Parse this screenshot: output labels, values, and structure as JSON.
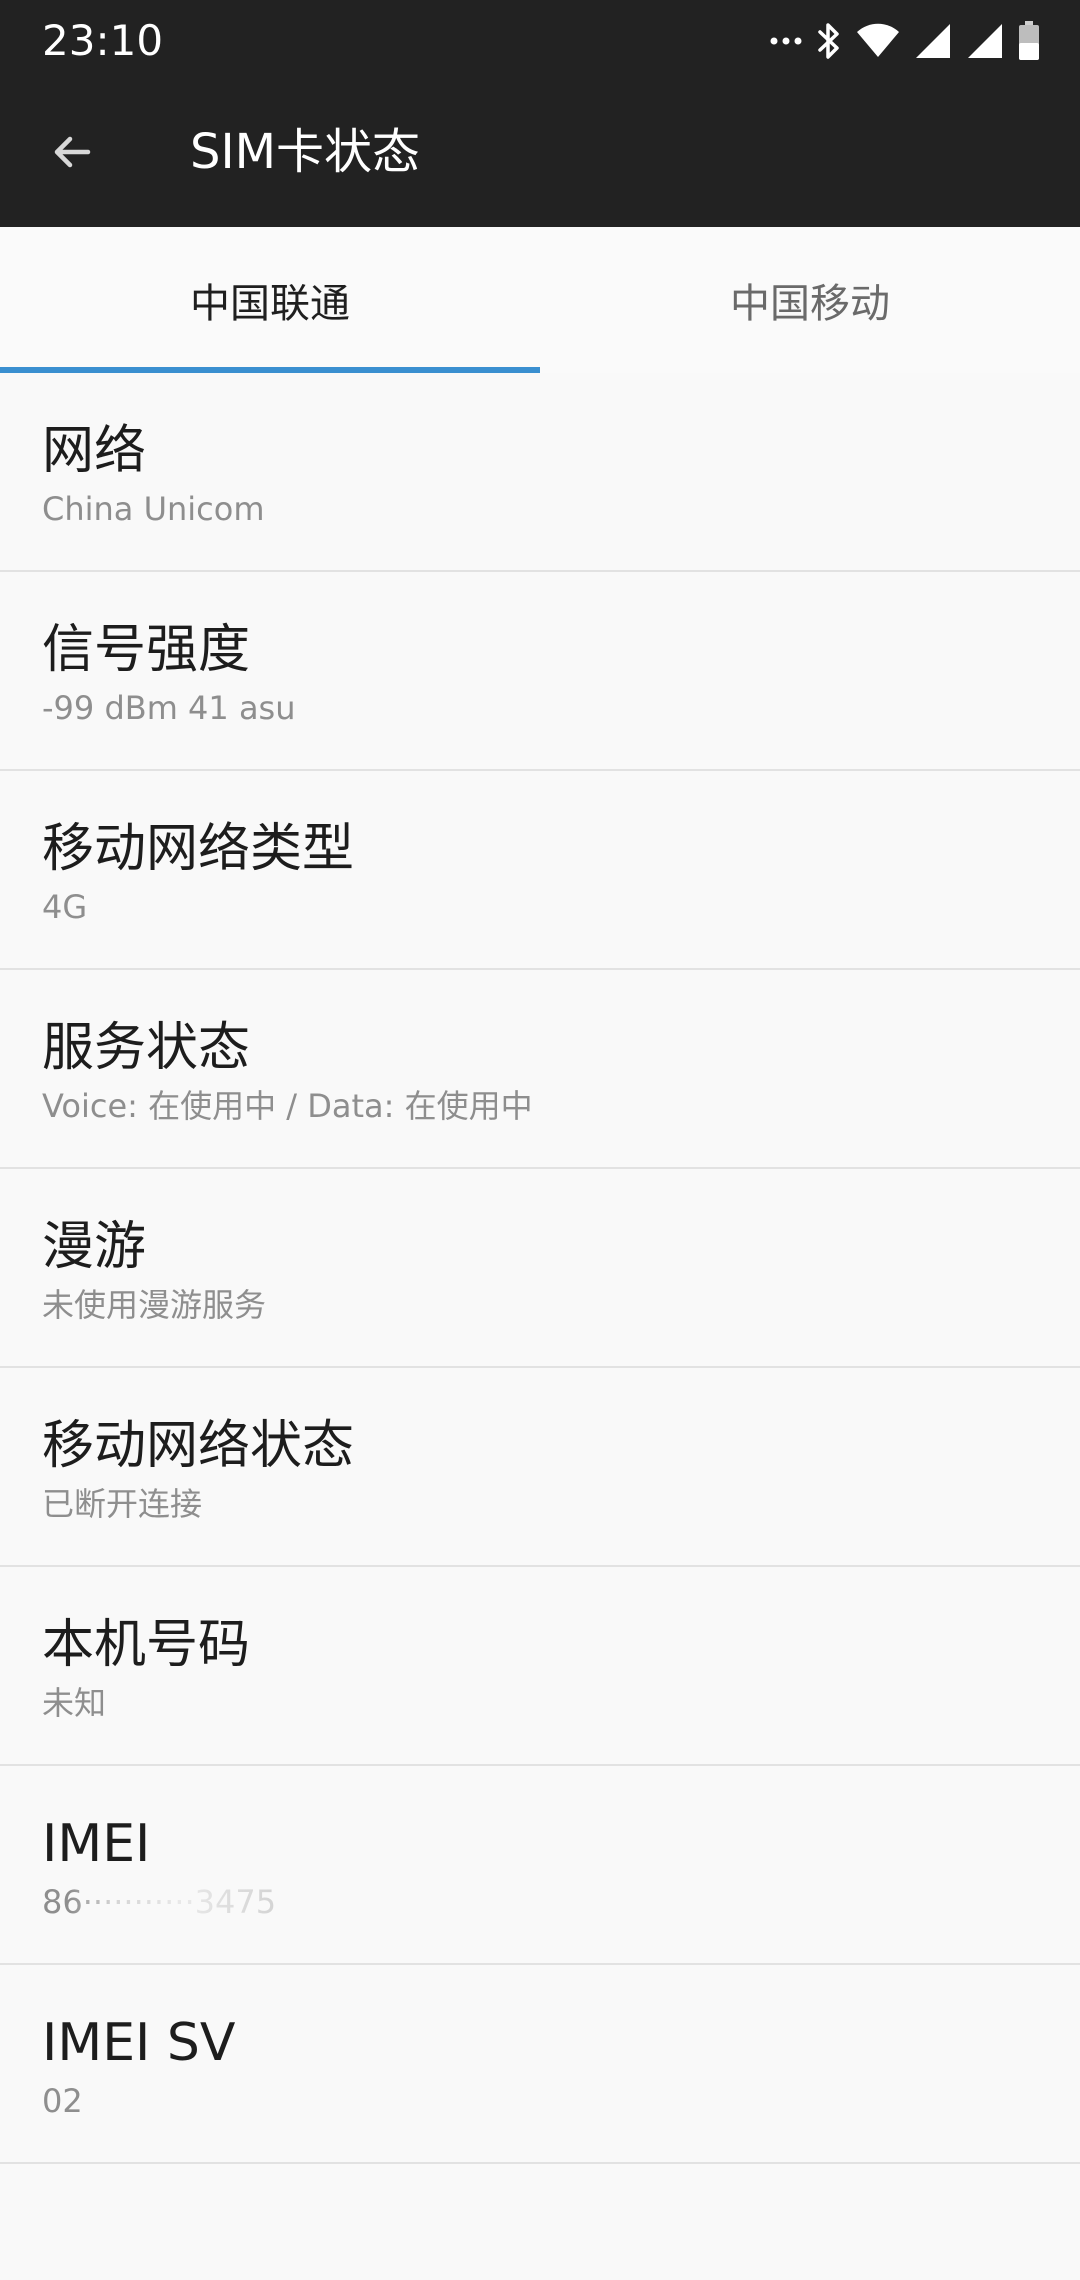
{
  "status_bar": {
    "time": "23:10",
    "icons": [
      "more-dots-icon",
      "bluetooth-icon",
      "wifi-icon",
      "cell-signal-icon",
      "cell-signal-icon",
      "battery-icon"
    ]
  },
  "app_bar": {
    "title": "SIM卡状态",
    "back_icon": "back-arrow-icon"
  },
  "tabs": [
    {
      "label": "中国联通",
      "active": true
    },
    {
      "label": "中国移动",
      "active": false
    }
  ],
  "colors": {
    "app_bar": "#222222",
    "accent": "#3a8fd0",
    "background": "#f9f9f9"
  },
  "items": [
    {
      "title": "网络",
      "value": "China Unicom"
    },
    {
      "title": "信号强度",
      "value": "-99 dBm 41 asu"
    },
    {
      "title": "移动网络类型",
      "value": "4G"
    },
    {
      "title": "服务状态",
      "value": "Voice: 在使用中 / Data: 在使用中"
    },
    {
      "title": "漫游",
      "value": "未使用漫游服务"
    },
    {
      "title": "移动网络状态",
      "value": "已断开连接"
    },
    {
      "title": "本机号码",
      "value": "未知"
    },
    {
      "title": "IMEI",
      "value": "86···········3475"
    },
    {
      "title": "IMEI SV",
      "value": "02"
    }
  ]
}
